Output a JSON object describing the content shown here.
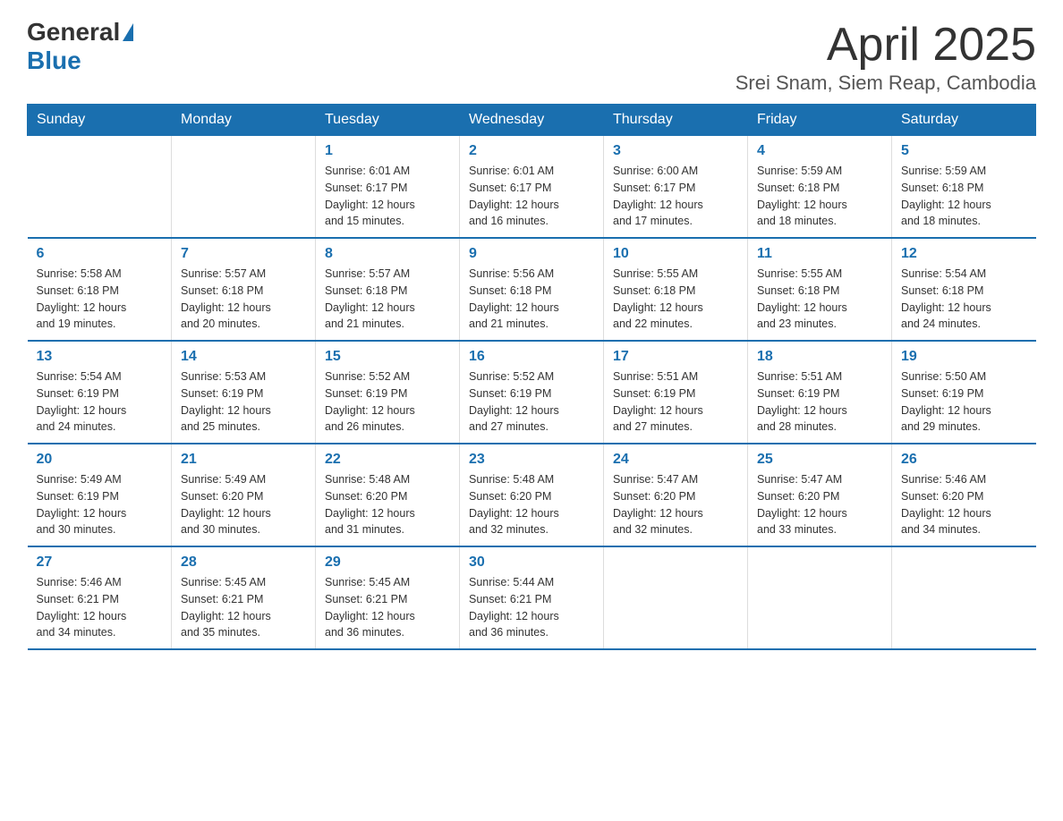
{
  "logo": {
    "general": "General",
    "triangle": "▶",
    "blue": "Blue"
  },
  "title": "April 2025",
  "subtitle": "Srei Snam, Siem Reap, Cambodia",
  "weekdays": [
    "Sunday",
    "Monday",
    "Tuesday",
    "Wednesday",
    "Thursday",
    "Friday",
    "Saturday"
  ],
  "weeks": [
    [
      {
        "day": "",
        "info": ""
      },
      {
        "day": "",
        "info": ""
      },
      {
        "day": "1",
        "info": "Sunrise: 6:01 AM\nSunset: 6:17 PM\nDaylight: 12 hours\nand 15 minutes."
      },
      {
        "day": "2",
        "info": "Sunrise: 6:01 AM\nSunset: 6:17 PM\nDaylight: 12 hours\nand 16 minutes."
      },
      {
        "day": "3",
        "info": "Sunrise: 6:00 AM\nSunset: 6:17 PM\nDaylight: 12 hours\nand 17 minutes."
      },
      {
        "day": "4",
        "info": "Sunrise: 5:59 AM\nSunset: 6:18 PM\nDaylight: 12 hours\nand 18 minutes."
      },
      {
        "day": "5",
        "info": "Sunrise: 5:59 AM\nSunset: 6:18 PM\nDaylight: 12 hours\nand 18 minutes."
      }
    ],
    [
      {
        "day": "6",
        "info": "Sunrise: 5:58 AM\nSunset: 6:18 PM\nDaylight: 12 hours\nand 19 minutes."
      },
      {
        "day": "7",
        "info": "Sunrise: 5:57 AM\nSunset: 6:18 PM\nDaylight: 12 hours\nand 20 minutes."
      },
      {
        "day": "8",
        "info": "Sunrise: 5:57 AM\nSunset: 6:18 PM\nDaylight: 12 hours\nand 21 minutes."
      },
      {
        "day": "9",
        "info": "Sunrise: 5:56 AM\nSunset: 6:18 PM\nDaylight: 12 hours\nand 21 minutes."
      },
      {
        "day": "10",
        "info": "Sunrise: 5:55 AM\nSunset: 6:18 PM\nDaylight: 12 hours\nand 22 minutes."
      },
      {
        "day": "11",
        "info": "Sunrise: 5:55 AM\nSunset: 6:18 PM\nDaylight: 12 hours\nand 23 minutes."
      },
      {
        "day": "12",
        "info": "Sunrise: 5:54 AM\nSunset: 6:18 PM\nDaylight: 12 hours\nand 24 minutes."
      }
    ],
    [
      {
        "day": "13",
        "info": "Sunrise: 5:54 AM\nSunset: 6:19 PM\nDaylight: 12 hours\nand 24 minutes."
      },
      {
        "day": "14",
        "info": "Sunrise: 5:53 AM\nSunset: 6:19 PM\nDaylight: 12 hours\nand 25 minutes."
      },
      {
        "day": "15",
        "info": "Sunrise: 5:52 AM\nSunset: 6:19 PM\nDaylight: 12 hours\nand 26 minutes."
      },
      {
        "day": "16",
        "info": "Sunrise: 5:52 AM\nSunset: 6:19 PM\nDaylight: 12 hours\nand 27 minutes."
      },
      {
        "day": "17",
        "info": "Sunrise: 5:51 AM\nSunset: 6:19 PM\nDaylight: 12 hours\nand 27 minutes."
      },
      {
        "day": "18",
        "info": "Sunrise: 5:51 AM\nSunset: 6:19 PM\nDaylight: 12 hours\nand 28 minutes."
      },
      {
        "day": "19",
        "info": "Sunrise: 5:50 AM\nSunset: 6:19 PM\nDaylight: 12 hours\nand 29 minutes."
      }
    ],
    [
      {
        "day": "20",
        "info": "Sunrise: 5:49 AM\nSunset: 6:19 PM\nDaylight: 12 hours\nand 30 minutes."
      },
      {
        "day": "21",
        "info": "Sunrise: 5:49 AM\nSunset: 6:20 PM\nDaylight: 12 hours\nand 30 minutes."
      },
      {
        "day": "22",
        "info": "Sunrise: 5:48 AM\nSunset: 6:20 PM\nDaylight: 12 hours\nand 31 minutes."
      },
      {
        "day": "23",
        "info": "Sunrise: 5:48 AM\nSunset: 6:20 PM\nDaylight: 12 hours\nand 32 minutes."
      },
      {
        "day": "24",
        "info": "Sunrise: 5:47 AM\nSunset: 6:20 PM\nDaylight: 12 hours\nand 32 minutes."
      },
      {
        "day": "25",
        "info": "Sunrise: 5:47 AM\nSunset: 6:20 PM\nDaylight: 12 hours\nand 33 minutes."
      },
      {
        "day": "26",
        "info": "Sunrise: 5:46 AM\nSunset: 6:20 PM\nDaylight: 12 hours\nand 34 minutes."
      }
    ],
    [
      {
        "day": "27",
        "info": "Sunrise: 5:46 AM\nSunset: 6:21 PM\nDaylight: 12 hours\nand 34 minutes."
      },
      {
        "day": "28",
        "info": "Sunrise: 5:45 AM\nSunset: 6:21 PM\nDaylight: 12 hours\nand 35 minutes."
      },
      {
        "day": "29",
        "info": "Sunrise: 5:45 AM\nSunset: 6:21 PM\nDaylight: 12 hours\nand 36 minutes."
      },
      {
        "day": "30",
        "info": "Sunrise: 5:44 AM\nSunset: 6:21 PM\nDaylight: 12 hours\nand 36 minutes."
      },
      {
        "day": "",
        "info": ""
      },
      {
        "day": "",
        "info": ""
      },
      {
        "day": "",
        "info": ""
      }
    ]
  ]
}
